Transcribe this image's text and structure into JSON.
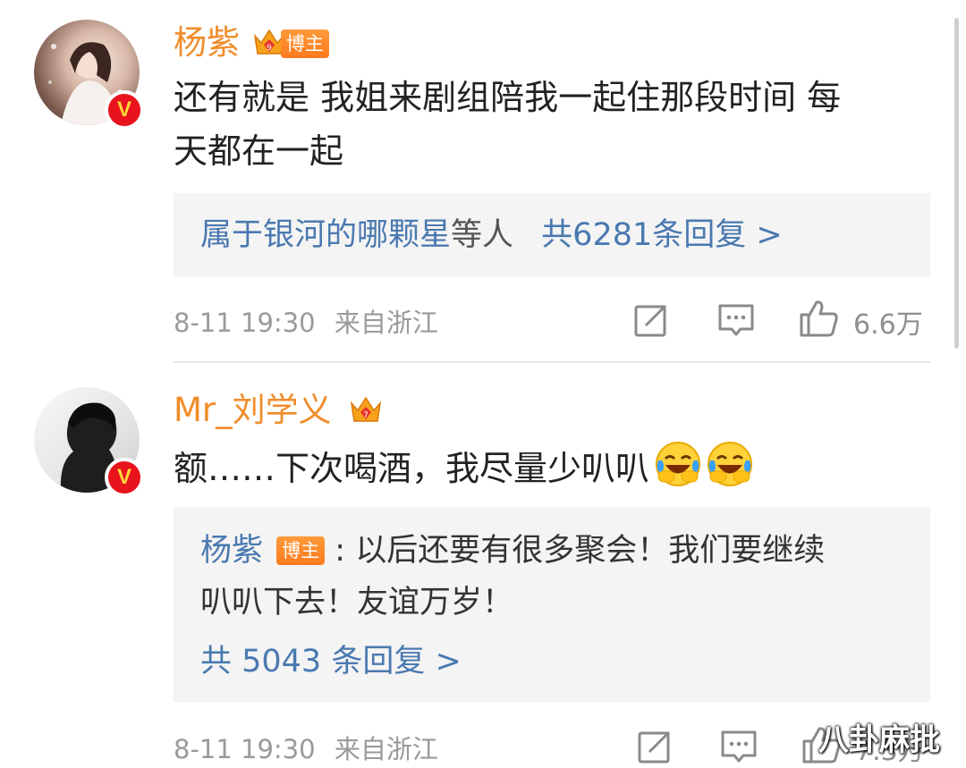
{
  "comments": [
    {
      "author": "杨紫",
      "tag": "博主",
      "text_line1": "还有就是 我姐来剧组陪我一起住那段时间 每",
      "text_line2": "天都在一起",
      "reply_users": "属于银河的哪颗星",
      "reply_etc": "等人",
      "reply_count": "共6281条回复 >",
      "time": "8-11 19:30",
      "location": "来自浙江",
      "likes": "6.6万"
    },
    {
      "author": "Mr_刘学义",
      "text": "额……下次喝酒，我尽量少叭叭",
      "emojis": [
        "laugh-cry-emoji",
        "laugh-cry-emoji"
      ],
      "reply_author": "杨紫",
      "reply_tag": "博主",
      "reply_text_line1": "以后还要有很多聚会！我们要继续",
      "reply_text_line2": "叭叭下去！友谊万岁！",
      "reply_count": "共 5043 条回复 >",
      "time": "8-11 19:30",
      "location": "来自浙江",
      "likes": "7.3万"
    }
  ],
  "watermark": "八卦麻批",
  "colors": {
    "name": "#f08d2a",
    "link": "#4a79b0",
    "vip": "#e8131d",
    "tag": "#ff8a2a"
  }
}
